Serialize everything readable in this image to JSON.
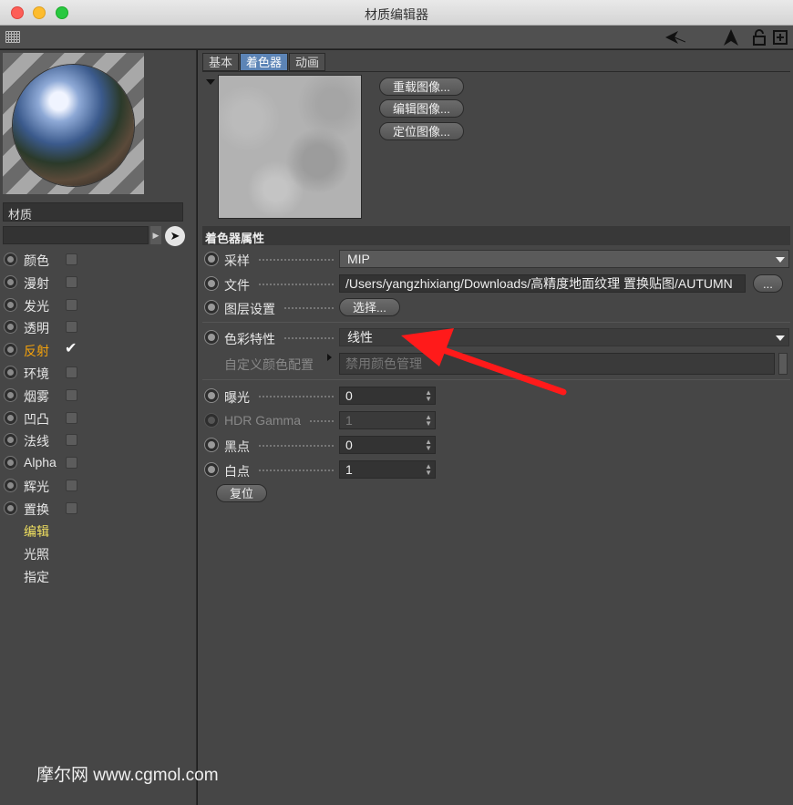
{
  "window": {
    "title": "材质编辑器"
  },
  "material": {
    "name": "材质"
  },
  "channels": [
    {
      "label": "颜色",
      "checked": false,
      "active": false
    },
    {
      "label": "漫射",
      "checked": false,
      "active": false
    },
    {
      "label": "发光",
      "checked": false,
      "active": false
    },
    {
      "label": "透明",
      "checked": false,
      "active": false
    },
    {
      "label": "反射",
      "checked": true,
      "active": true
    },
    {
      "label": "环境",
      "checked": false,
      "active": false
    },
    {
      "label": "烟雾",
      "checked": false,
      "active": false
    },
    {
      "label": "凹凸",
      "checked": false,
      "active": false
    },
    {
      "label": "法线",
      "checked": false,
      "active": false
    },
    {
      "label": "Alpha",
      "checked": false,
      "active": false
    },
    {
      "label": "辉光",
      "checked": false,
      "active": false
    },
    {
      "label": "置换",
      "checked": false,
      "active": false
    }
  ],
  "sub_items": [
    {
      "label": "编辑",
      "active": true
    },
    {
      "label": "光照",
      "active": false
    },
    {
      "label": "指定",
      "active": false
    }
  ],
  "tabs": [
    "基本",
    "着色器",
    "动画"
  ],
  "active_tab": "着色器",
  "image_buttons": [
    "重载图像...",
    "编辑图像...",
    "定位图像..."
  ],
  "section_title": "着色器属性",
  "props": {
    "sampling": {
      "label": "采样",
      "value": "MIP"
    },
    "file": {
      "label": "文件",
      "value": "/Users/yangzhixiang/Downloads/高精度地面纹理 置换贴图/AUTUMN",
      "browse": "..."
    },
    "layer": {
      "label": "图层设置",
      "button": "选择..."
    },
    "color_profile": {
      "label": "色彩特性",
      "value": "线性"
    },
    "custom_profile": {
      "label": "自定义颜色配置",
      "value": "禁用颜色管理"
    },
    "exposure": {
      "label": "曝光",
      "value": "0"
    },
    "hdr_gamma": {
      "label": "HDR Gamma",
      "value": "1"
    },
    "black_point": {
      "label": "黑点",
      "value": "0"
    },
    "white_point": {
      "label": "白点",
      "value": "1"
    },
    "reset": "复位"
  },
  "watermark": "摩尔网 www.cgmol.com",
  "colors": {
    "accent_tab": "#5c84b6",
    "active_channel": "#f4a20b",
    "active_sub": "#f0e060",
    "arrow": "#ff1a1a"
  }
}
